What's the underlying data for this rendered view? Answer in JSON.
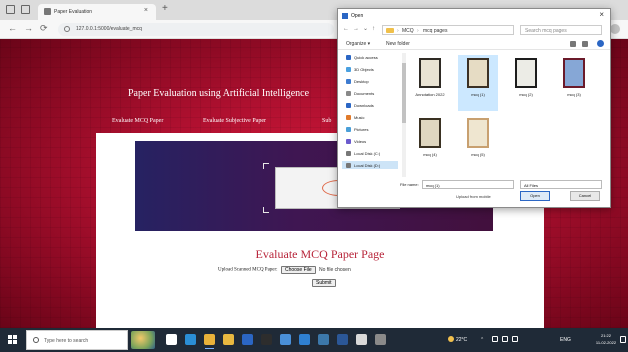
{
  "browser": {
    "tab_title": "Paper Evaluation",
    "tab_close": "×",
    "new_tab": "+",
    "url": "127.0.0.1:5000/evaluate_mcq",
    "nav": {
      "back": "←",
      "forward": "→",
      "reload": "⟳"
    }
  },
  "page": {
    "site_title": "Paper Evaluation using Artificial Intelligence",
    "nav_links": [
      "Evaluate MCQ Paper",
      "Evaluate Subjective Paper",
      "Sub"
    ],
    "section_title": "Evaluate MCQ Paper Page",
    "upload_label": "Upload Scanned MCQ Paper:",
    "choose_button": "Choose File",
    "no_file_text": "No file chosen",
    "submit_button": "Submit"
  },
  "dialog": {
    "title": "Open",
    "close": "×",
    "breadcrumb": [
      "MCQ",
      "mcq pages"
    ],
    "search_placeholder": "Search mcq pages",
    "organize": "Organize ▾",
    "new_folder": "New folder",
    "nav_items": [
      {
        "label": "Quick access",
        "icon": "star-icon",
        "color": "#2b66c4"
      },
      {
        "label": "3D Objects",
        "icon": "cube-icon",
        "color": "#4aa0e0"
      },
      {
        "label": "Desktop",
        "icon": "desktop-icon",
        "color": "#3d7bd0"
      },
      {
        "label": "Documents",
        "icon": "document-icon",
        "color": "#888888"
      },
      {
        "label": "Downloads",
        "icon": "download-icon",
        "color": "#2b66c4"
      },
      {
        "label": "Music",
        "icon": "music-icon",
        "color": "#e07a2b"
      },
      {
        "label": "Pictures",
        "icon": "pictures-icon",
        "color": "#4a9fd8"
      },
      {
        "label": "Videos",
        "icon": "video-icon",
        "color": "#6a5acd"
      },
      {
        "label": "Local Disk (C:)",
        "icon": "drive-icon",
        "color": "#777777"
      },
      {
        "label": "Local Disk (D:)",
        "icon": "drive-icon",
        "color": "#777777"
      }
    ],
    "files": [
      {
        "name": "Annotation 2022",
        "frame": "#2e2a24",
        "fill": "#e9e3d3"
      },
      {
        "name": "mcq (1)",
        "frame": "#3b3024",
        "fill": "#e6dcc4"
      },
      {
        "name": "mcq (2)",
        "frame": "#1d1d1d",
        "fill": "#ecece6"
      },
      {
        "name": "mcq (3)",
        "frame": "#6b1a2a",
        "fill": "#86a7d6"
      },
      {
        "name": "mcq (4)",
        "frame": "#3a3122",
        "fill": "#dfd6bf"
      },
      {
        "name": "mcq (5)",
        "frame": "#c8a070",
        "fill": "#efe6d0"
      }
    ],
    "filename_label": "File name:",
    "filename_value": "mcq (1)",
    "filetype_value": "All Files",
    "upload_from_mobile": "Upload from mobile",
    "open_button": "Open",
    "cancel_button": "Cancel"
  },
  "taskbar": {
    "search_placeholder": "Type here to search",
    "weather": "22°C",
    "language": "ENG",
    "clock_time": "21:22",
    "clock_date": "11-02-2022",
    "apps": [
      {
        "icon": "task-view-icon",
        "color": "#ffffff"
      },
      {
        "icon": "edge-icon",
        "color": "#2b8fd6"
      },
      {
        "icon": "chrome-icon",
        "color": "#e9b23a"
      },
      {
        "icon": "file-explorer-icon",
        "color": "#e8b840"
      },
      {
        "icon": "mail-icon",
        "color": "#2b66c4"
      },
      {
        "icon": "terminal-icon",
        "color": "#2d2d2d"
      },
      {
        "icon": "store-icon",
        "color": "#4a90d9"
      },
      {
        "icon": "vscode-icon",
        "color": "#2f80d1"
      },
      {
        "icon": "python-icon",
        "color": "#3c78aa"
      },
      {
        "icon": "word-icon",
        "color": "#2b5797"
      },
      {
        "icon": "photos-icon",
        "color": "#d9d9d9"
      },
      {
        "icon": "settings-icon",
        "color": "#8a8a8a"
      }
    ]
  }
}
